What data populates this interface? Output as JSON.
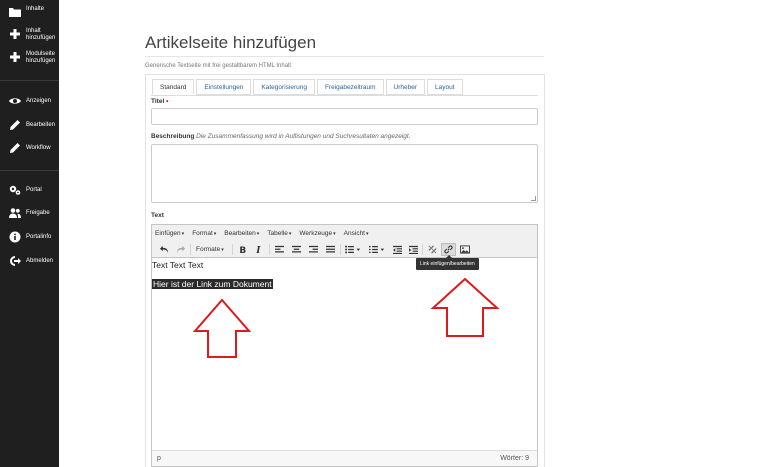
{
  "sidebar": {
    "items": [
      {
        "label": "Inhalte",
        "icon": "folder-icon"
      },
      {
        "label": "Inhalt\nhinzufügen",
        "icon": "plus-icon"
      },
      {
        "label": "Modulseite\nhinzufügen",
        "icon": "plus-icon"
      },
      {
        "label": "Anzeigen",
        "icon": "eye-icon"
      },
      {
        "label": "Bearbeiten",
        "icon": "pencil-icon"
      },
      {
        "label": "Workflow",
        "icon": "pencil-icon"
      },
      {
        "label": "Portal",
        "icon": "gears-icon"
      },
      {
        "label": "Freigabe",
        "icon": "users-icon"
      },
      {
        "label": "Portalinfo",
        "icon": "info-icon"
      },
      {
        "label": "Abmelden",
        "icon": "logout-icon"
      }
    ]
  },
  "header": {
    "title": "Artikelseite hinzufügen",
    "subtitle": "Generische Textseite mit frei gestaltbarem HTML Inhalt"
  },
  "tabs": [
    {
      "label": "Standard",
      "active": true
    },
    {
      "label": "Einstellungen"
    },
    {
      "label": "Kategorisierung"
    },
    {
      "label": "Freigabezeitraum"
    },
    {
      "label": "Urheber"
    },
    {
      "label": "Layout"
    }
  ],
  "form": {
    "title_label": "Titel",
    "required_mark": "•",
    "title_value": "",
    "description_label": "Beschreibung",
    "description_hint": "Die Zusammenfassung wird in Auflistungen und Suchresultaten angezeigt.",
    "description_value": "",
    "text_label": "Text"
  },
  "editor": {
    "menus": [
      "Einfügen",
      "Format",
      "Bearbeiten",
      "Tabelle",
      "Werkzeuge",
      "Ansicht"
    ],
    "formats_label": "Formate",
    "line1": "Text Text Text",
    "line2": "Hier ist der Link zum Dokument",
    "status_path": "p",
    "word_count": "Wörter: 9"
  },
  "tooltip": "Link einfügen/bearbeiten",
  "colors": {
    "sidebar_bg": "#1f1f1f",
    "arrow": "#e0191c",
    "link": "#2a6496",
    "selection_bg": "#2b2b2b"
  }
}
